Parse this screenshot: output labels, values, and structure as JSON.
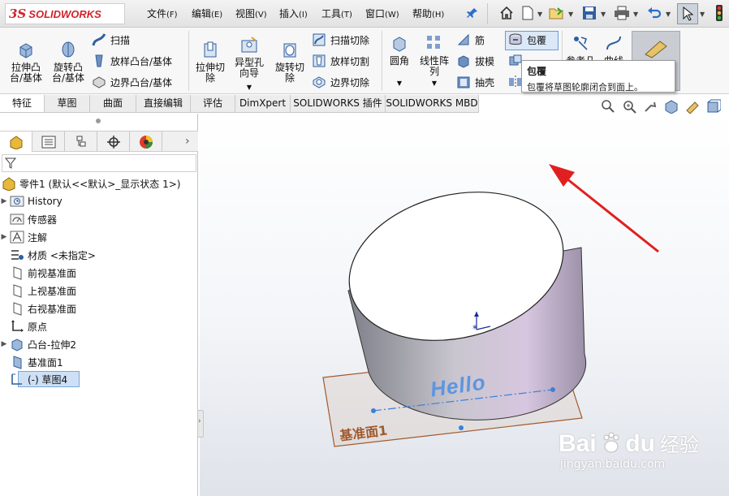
{
  "app": {
    "logo_ds": "3S",
    "logo_text": "SOLIDWORKS"
  },
  "menu": [
    {
      "label": "文件",
      "key": "(F)"
    },
    {
      "label": "编辑",
      "key": "(E)"
    },
    {
      "label": "视图",
      "key": "(V)"
    },
    {
      "label": "插入",
      "key": "(I)"
    },
    {
      "label": "工具",
      "key": "(T)"
    },
    {
      "label": "窗口",
      "key": "(W)"
    },
    {
      "label": "帮助",
      "key": "(H)"
    }
  ],
  "toolbar_icons": [
    "pin-icon",
    "home-icon",
    "new-file-icon",
    "open-file-icon",
    "save-icon",
    "print-icon",
    "undo-icon",
    "select-arrow-icon",
    "traffic-light-icon"
  ],
  "features": {
    "extrude_boss": "拉伸凸\n台/基体",
    "revolve_boss": "旋转凸\n台/基体",
    "sweep": "扫描",
    "loft_boss": "放样凸台/基体",
    "boundary_boss": "边界凸台/基体",
    "extrude_cut": "拉伸切\n除",
    "hole_wizard": "异型孔\n向导",
    "revolve_cut": "旋转切\n除",
    "sweep_cut": "扫描切除",
    "loft_cut": "放样切割",
    "boundary_cut": "边界切除",
    "fillet": "圆角",
    "linear_pattern": "线性阵\n列",
    "rib": "筋",
    "draft": "拔模",
    "shell": "抽壳",
    "wrap": "包覆",
    "ref_geometry": "参考几",
    "curves": "曲线"
  },
  "tooltip": {
    "title": "包覆",
    "desc": "包覆将草图轮廓闭合到面上。"
  },
  "tabs": [
    "特征",
    "草图",
    "曲面",
    "直接编辑",
    "评估",
    "DimXpert",
    "SOLIDWORKS 插件",
    "SOLIDWORKS MBD"
  ],
  "tree": {
    "root": "零件1 (默认<<默认>_显示状态 1>)",
    "items": [
      "History",
      "传感器",
      "注解",
      "材质 <未指定>",
      "前视基准面",
      "上视基准面",
      "右视基准面",
      "原点",
      "凸台-拉伸2",
      "基准面1",
      "(-) 草图4"
    ]
  },
  "viewport": {
    "plane_label": "基准面1",
    "sketch_text": "Hello"
  },
  "watermark": {
    "brand": "Bai",
    "brand2": "du",
    "cn": "经验",
    "url": "jingyan.baidu.com"
  },
  "colors": {
    "accent": "#d2232a",
    "selection": "#cde0f5",
    "arrow": "#e02020",
    "plane": "#a05a2c",
    "sketch": "#3d7fd6"
  }
}
